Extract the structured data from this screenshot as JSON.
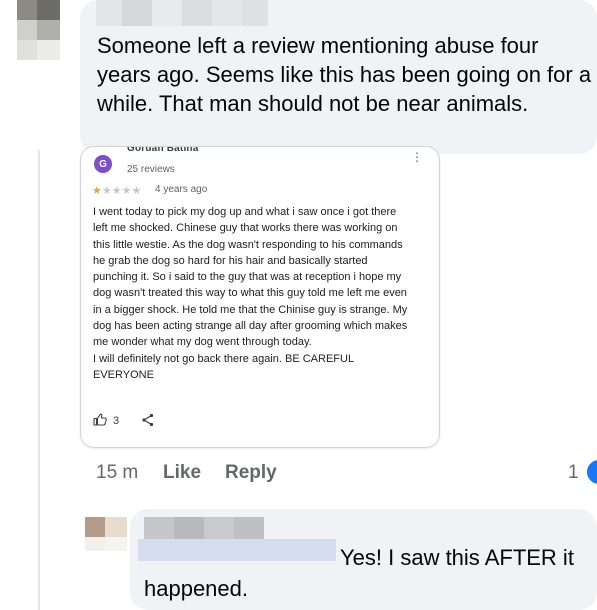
{
  "comment1": {
    "author_hidden": true,
    "text": "Someone left a review mentioning abuse four years ago. Seems like this has been going on for a while. That man should not be near animals."
  },
  "review": {
    "avatar_letter": "G",
    "reviewer_name": "Gordan Batina",
    "review_count": "25 reviews",
    "rating": 1,
    "rating_max": 5,
    "date": "4 years ago",
    "paragraphs": [
      "I went today to pick my dog up and what i saw once i got there left me shocked. Chinese guy that works there was working on this little westie. As the dog wasn't responding to his commands he grab the dog so hard for his hair and basically started punching it. So i said to the guy that was at reception i hope my dog wasn't treated this way to what this guy told me left me even in a bigger shock. He told me that the Chinise guy is strange. My dog has been acting strange all day after grooming which makes me wonder what my dog went through today.",
      "I will definitely not go back there again. BE CAREFUL EVERYONE"
    ],
    "helpful_count": "3"
  },
  "comment1_meta": {
    "time": "15 m",
    "like_label": "Like",
    "reply_label": "Reply",
    "reaction_count": "1"
  },
  "comment2": {
    "author_hidden": true,
    "text": "Yes! I saw this AFTER it happened."
  },
  "colors": {
    "bubble_bg": "#f0f2f5",
    "meta_text": "#65676b",
    "reaction_blue": "#1877f2",
    "star_gold": "#e0a82e",
    "avatar_purple": "#7b4fc9"
  }
}
